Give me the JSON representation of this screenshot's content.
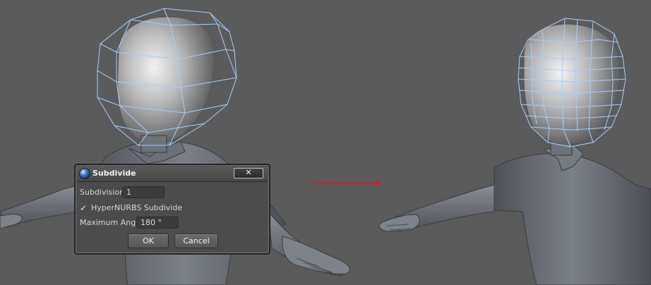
{
  "dialog": {
    "title": "Subdivide",
    "close_label": "✕",
    "fields": {
      "subdivision_label": "Subdivision",
      "subdivision_value": "1",
      "hypernurbs_label": "HyperNURBS Subdivide",
      "hypernurbs_checked": true,
      "hypernurbs_mark": "✓",
      "max_angle_label": "Maximum Angle",
      "max_angle_value": "180 °"
    },
    "buttons": {
      "ok": "OK",
      "cancel": "Cancel"
    }
  },
  "viewport": {
    "background_color": "#5b5b5b",
    "mesh_color": "#9fcfff",
    "arrow_color": "#d62020",
    "before_model": "character-low-subdivision",
    "after_model": "character-subdivided"
  }
}
